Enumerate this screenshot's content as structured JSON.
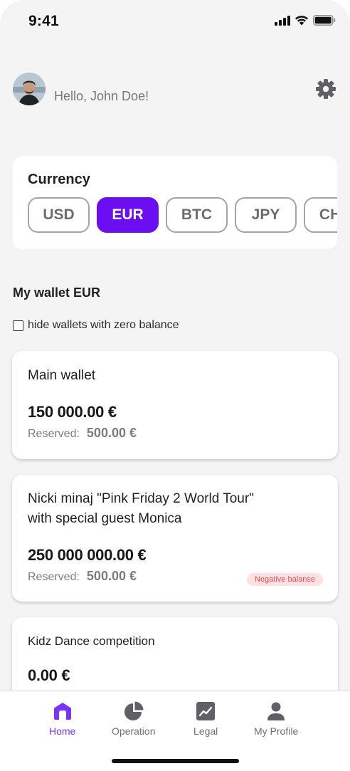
{
  "status_bar": {
    "time": "9:41"
  },
  "header": {
    "greeting": "Hello, John Doe!"
  },
  "currency": {
    "title": "Currency",
    "options": [
      "USD",
      "EUR",
      "BTC",
      "JPY",
      "CHF"
    ],
    "selected": "EUR"
  },
  "wallet_section": {
    "heading": "My wallet EUR",
    "hide_zero_label": "hide wallets with zero balance",
    "hide_zero_checked": false
  },
  "wallets": [
    {
      "name": "Main wallet",
      "amount": "150 000.00 €",
      "reserved_label": "Reserved:",
      "reserved_value": "500.00 €"
    },
    {
      "name_line1": "Nicki minaj \"Pink Friday 2 World Tour\"",
      "name_line2": "with special guest Monica",
      "amount": "250 000 000.00 €",
      "reserved_label": "Reserved:",
      "reserved_value": "500.00 €",
      "badge": "Negative balanse"
    },
    {
      "name": "Kidz Dance competition",
      "amount": "0.00 €"
    }
  ],
  "tabs": [
    {
      "label": "Home",
      "icon": "home-icon",
      "active": true
    },
    {
      "label": "Operation",
      "icon": "pie-chart-icon",
      "active": false
    },
    {
      "label": "Legal",
      "icon": "chart-line-icon",
      "active": false
    },
    {
      "label": "My Profile",
      "icon": "user-icon",
      "active": false
    }
  ],
  "colors": {
    "accent": "#6b0ff2",
    "tab_active": "#7a34f5",
    "badge_bg": "#ffe1e2",
    "badge_text": "#ea4b54",
    "background": "#f4f4f5"
  }
}
